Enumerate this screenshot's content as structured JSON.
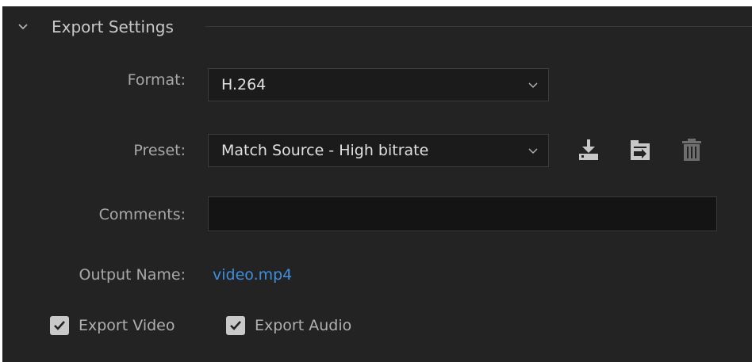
{
  "section": {
    "title": "Export Settings",
    "expanded": true
  },
  "format": {
    "label": "Format:",
    "value": "H.264"
  },
  "preset": {
    "label": "Preset:",
    "value": "Match Source - High bitrate",
    "actions": [
      {
        "name": "save-preset-icon"
      },
      {
        "name": "import-preset-icon"
      },
      {
        "name": "delete-preset-icon"
      }
    ]
  },
  "comments": {
    "label": "Comments:",
    "value": "",
    "placeholder": ""
  },
  "output": {
    "label": "Output Name:",
    "value": "video.mp4"
  },
  "checkboxes": {
    "export_video": {
      "label": "Export Video",
      "checked": true
    },
    "export_audio": {
      "label": "Export Audio",
      "checked": true
    }
  },
  "colors": {
    "background": "#232323",
    "link": "#3d8fe0",
    "checkbox": "#c9c9c9"
  }
}
